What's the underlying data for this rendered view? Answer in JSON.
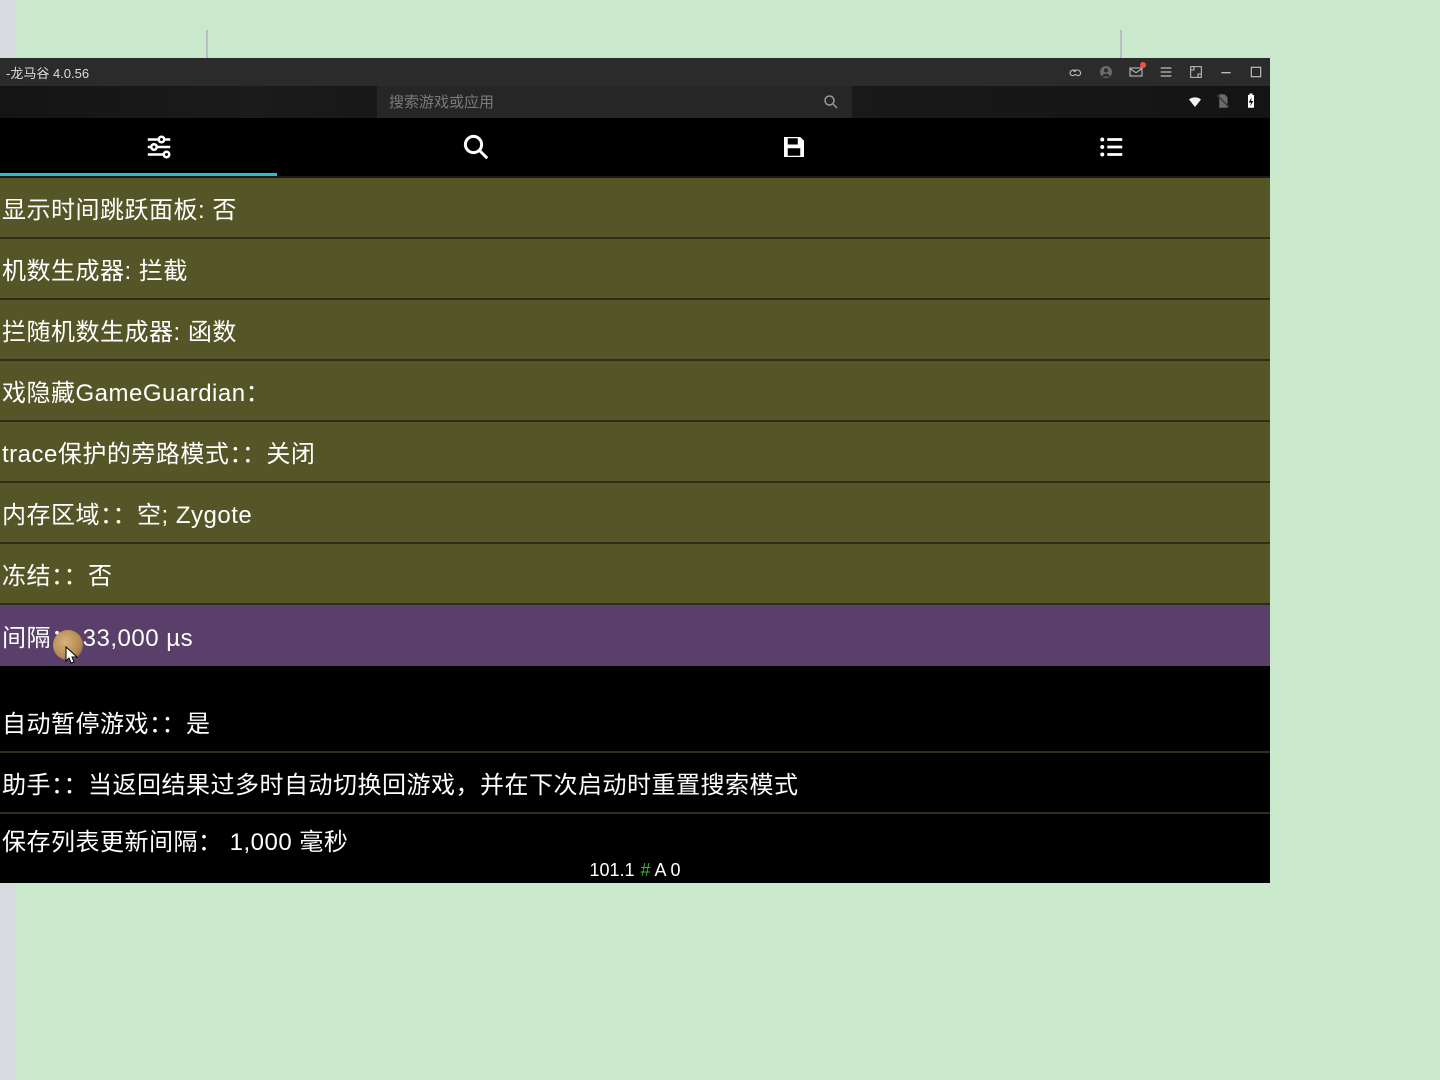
{
  "titlebar": {
    "title": "-龙马谷 4.0.56"
  },
  "top_search": {
    "placeholder": "搜索游戏或应用"
  },
  "settings": {
    "rows_olive": [
      "显示时间跳跃面板: 否",
      "机数生成器: 拦截",
      "拦随机数生成器: 函数",
      "戏隐藏GameGuardian：",
      "trace保护的旁路模式：：关闭",
      "内存区域：：空; Zygote",
      "冻结：：否",
      "间隔： 33,000 µs"
    ],
    "rows_black": [
      "自动暂停游戏：：是",
      "助手：：当返回结果过多时自动切换回游戏，并在下次启动时重置搜索模式",
      "保存列表更新间隔： 1,000 毫秒"
    ]
  },
  "statusbar": {
    "version": "101.1",
    "hash": "#",
    "suffix": "A 0"
  }
}
